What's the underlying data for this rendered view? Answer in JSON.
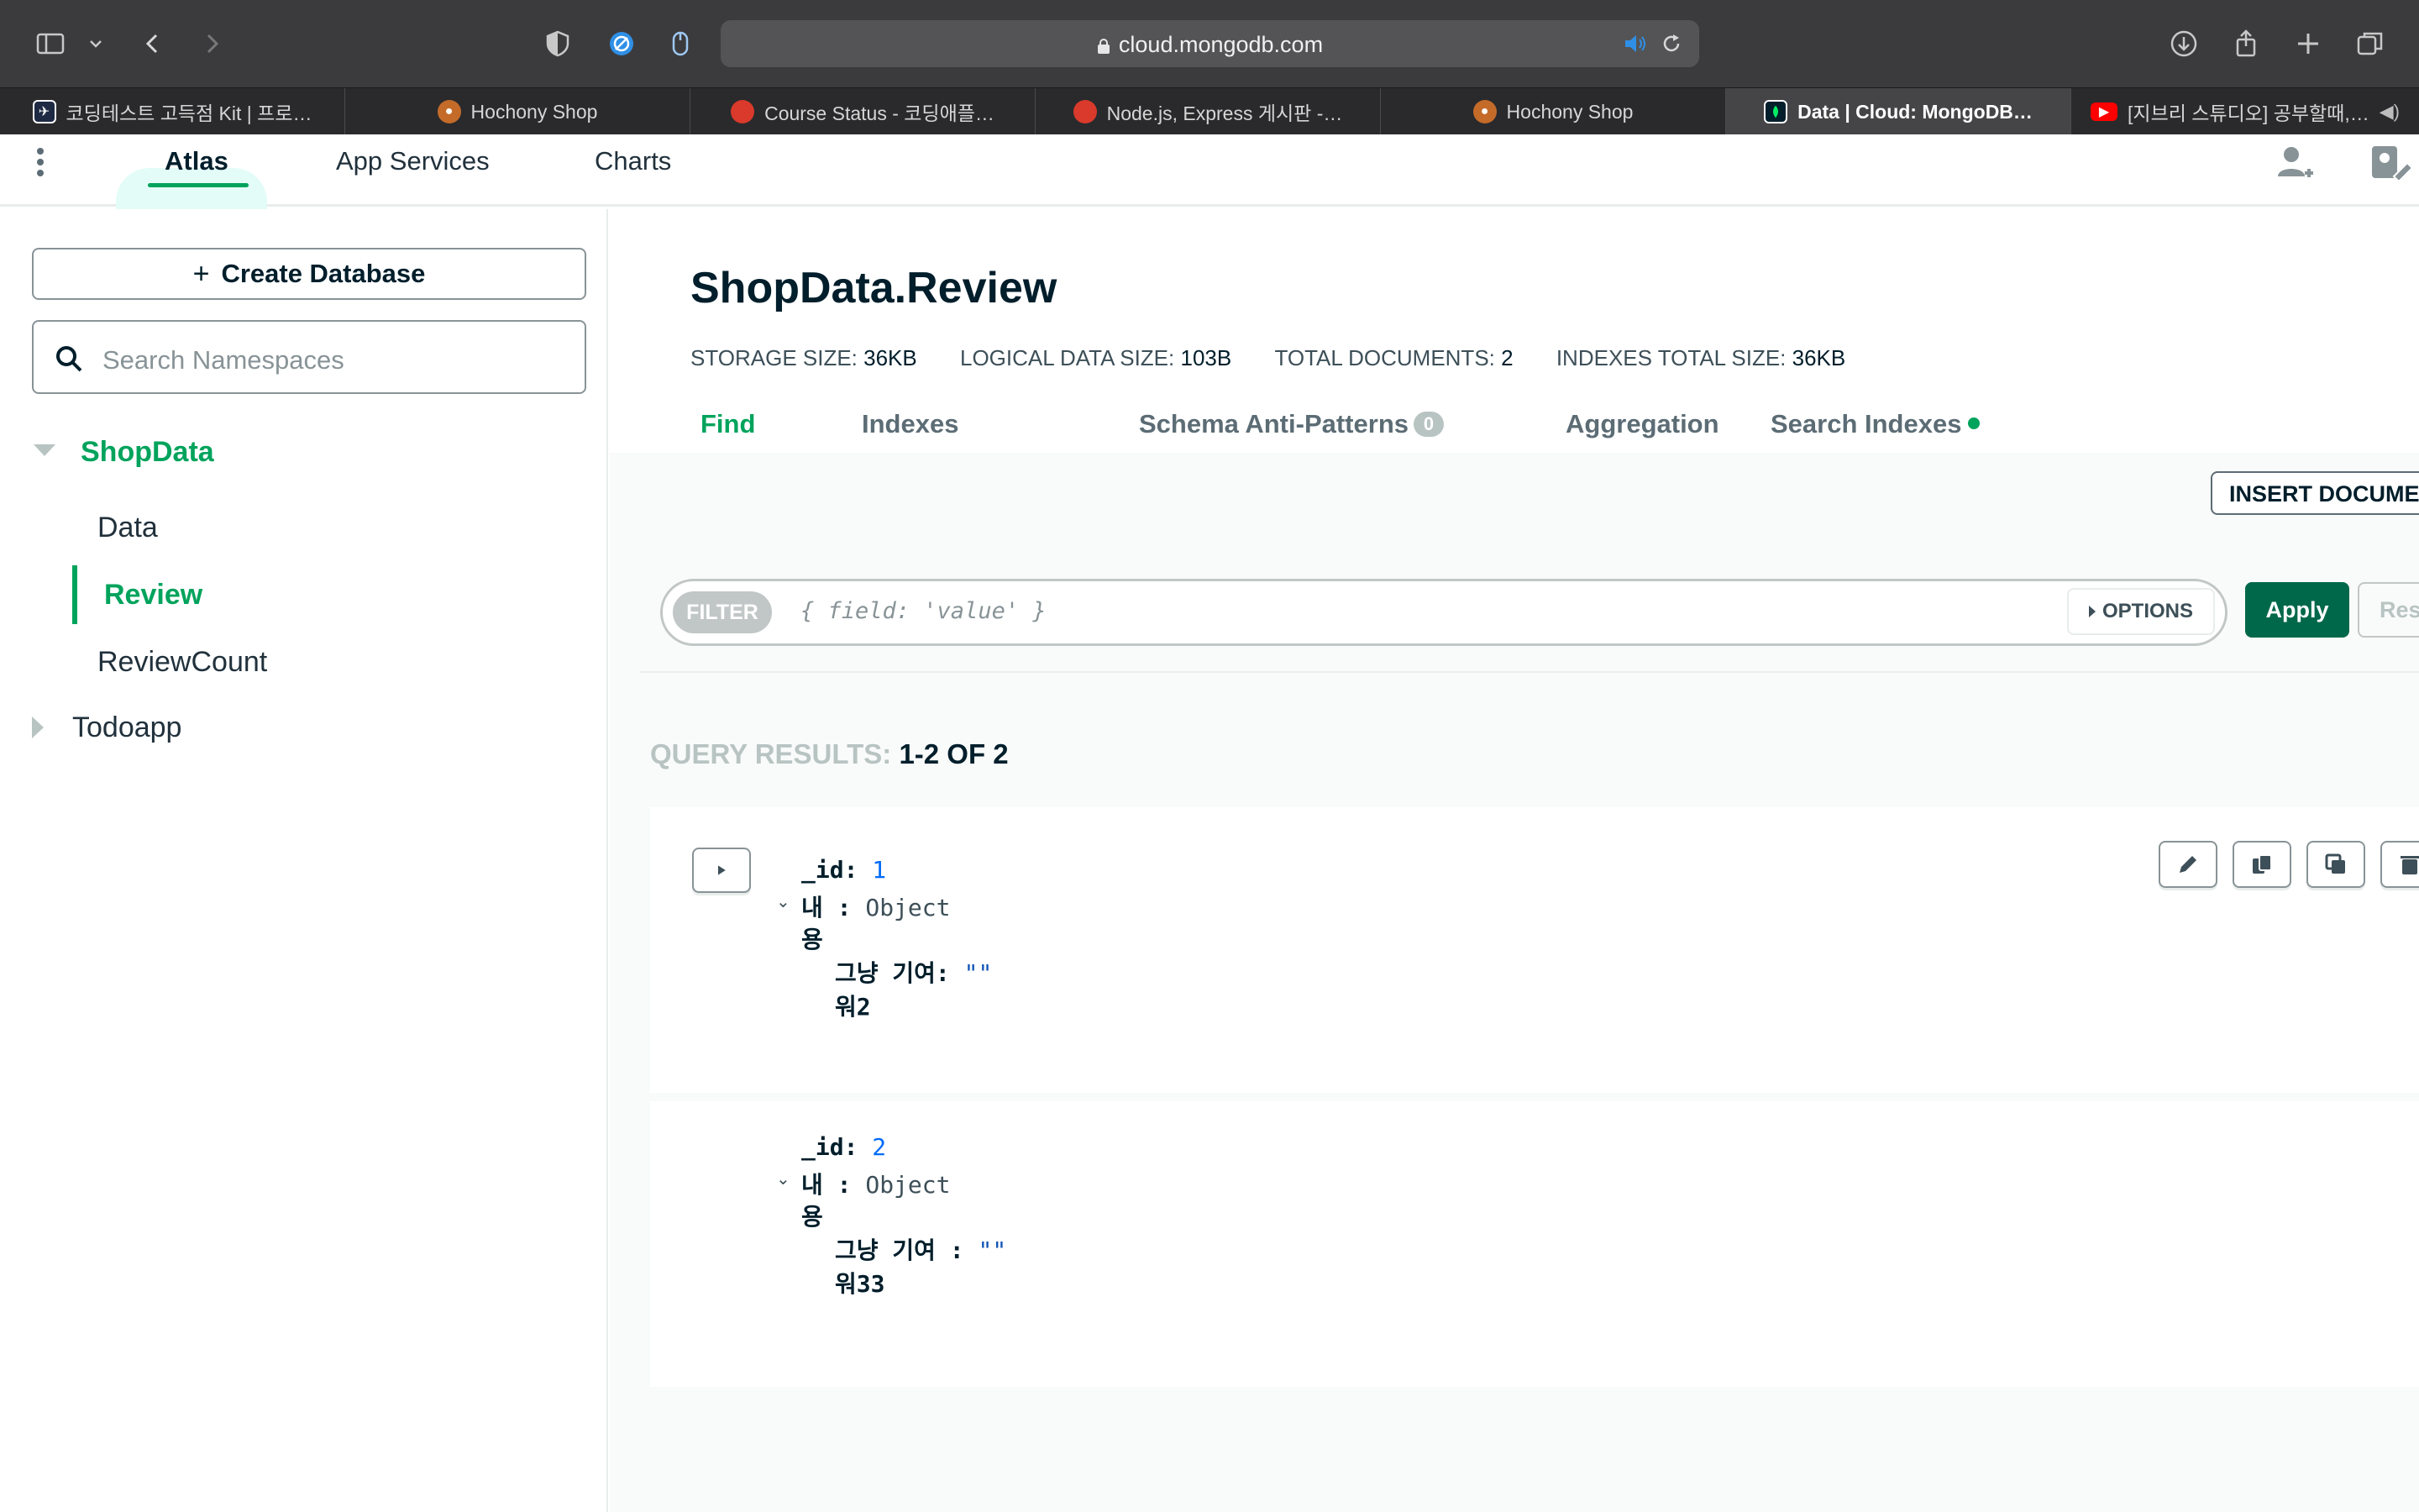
{
  "browser": {
    "url": "cloud.mongodb.com",
    "tabs": [
      {
        "title": "코딩테스트 고득점 Kit | 프로…",
        "favicon_color": "#1e2a44",
        "icon": "programmers-icon"
      },
      {
        "title": "Hochony Shop",
        "favicon_color": "#c46b2a",
        "icon": "hochony-icon"
      },
      {
        "title": "Course Status - 코딩애플…",
        "favicon_color": "#d93a2b",
        "icon": "apple-icon"
      },
      {
        "title": "Node.js, Express 게시판 -…",
        "favicon_color": "#d93a2b",
        "icon": "apple-icon"
      },
      {
        "title": "Hochony Shop",
        "favicon_color": "#c46b2a",
        "icon": "hochony-icon"
      },
      {
        "title": "Data | Cloud: MongoDB…",
        "favicon_color": "#00a35c",
        "icon": "mongodb-leaf-icon"
      },
      {
        "title": "[지브리 스튜디오] 공부할때,…",
        "favicon_color": "#ff0000",
        "icon": "youtube-icon"
      }
    ],
    "active_tab": 5
  },
  "atlas_nav": {
    "tabs": [
      "Atlas",
      "App Services",
      "Charts"
    ]
  },
  "sidebar": {
    "create_database": "Create Database",
    "search_placeholder": "Search Namespaces",
    "databases": [
      {
        "name": "ShopData",
        "expanded": true,
        "collections": [
          "Data",
          "Review",
          "ReviewCount"
        ]
      },
      {
        "name": "Todoapp",
        "expanded": false,
        "collections": []
      }
    ],
    "selected_collection": "Review"
  },
  "collection": {
    "title": "ShopData.Review",
    "stats": [
      {
        "label": "STORAGE SIZE:",
        "value": "36KB"
      },
      {
        "label": "LOGICAL DATA SIZE:",
        "value": "103B"
      },
      {
        "label": "TOTAL DOCUMENTS:",
        "value": "2"
      },
      {
        "label": "INDEXES TOTAL SIZE:",
        "value": "36KB"
      }
    ],
    "tabs": {
      "find": "Find",
      "indexes": "Indexes",
      "anti_patterns": "Schema Anti-Patterns",
      "anti_patterns_count": "0",
      "aggregation": "Aggregation",
      "search_indexes": "Search Indexes"
    },
    "active_tab": "Find"
  },
  "query": {
    "insert_button": "INSERT DOCUMENT",
    "filter_label": "FILTER",
    "filter_placeholder": "{ field: 'value' }",
    "options_label": "OPTIONS",
    "apply_label": "Apply",
    "reset_label": "Reset",
    "results_label": "QUERY RESULTS:",
    "results_count": "1-2 OF 2"
  },
  "documents": [
    {
      "id_key": "_id:",
      "id_value": "1",
      "obj_key_1": "내",
      "obj_key_2": "용",
      "obj_sep": ":",
      "obj_type": "Object",
      "field_key_1": "그냥 기여",
      "field_key_2": "워2",
      "field_sep": ":",
      "field_value": "\"\""
    },
    {
      "id_key": "_id:",
      "id_value": "2",
      "obj_key_1": "내",
      "obj_key_2": "용",
      "obj_sep": ":",
      "obj_type": "Object",
      "field_key_1": "그냥 기여 ",
      "field_key_2": "워33",
      "field_sep": ":",
      "field_value": "\"\""
    }
  ],
  "colors": {
    "accent": "#00a35c",
    "apply": "#00684a",
    "browser_chrome": "#3b3b3d"
  }
}
